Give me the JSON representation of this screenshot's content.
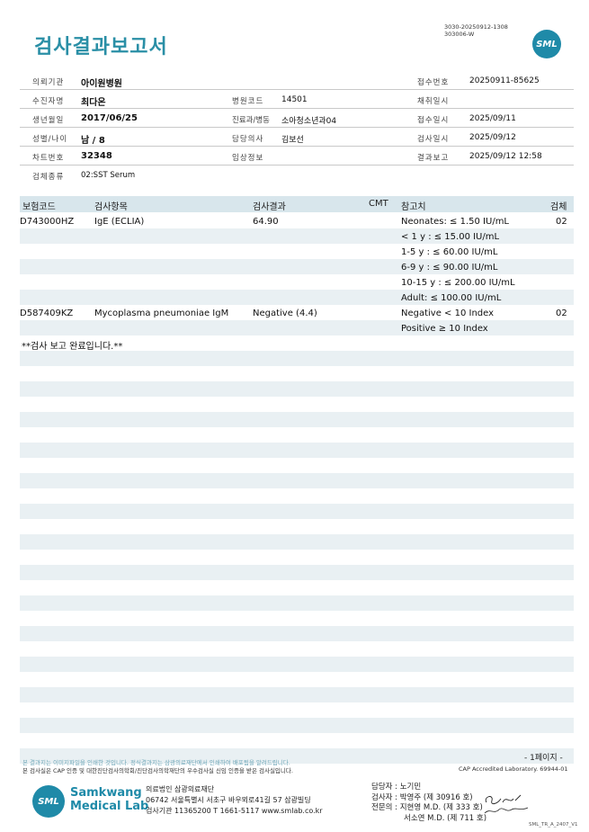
{
  "title": "검사결과보고서",
  "doc_ids": [
    "3030-20250912-1308",
    "303006-W"
  ],
  "logo_text": "SML",
  "header": {
    "client_label": "의뢰기관",
    "client": "아이원병원",
    "receipt_no_label": "접수번호",
    "receipt_no": "20250911-85625",
    "patient_label": "수진자명",
    "patient": "최다온",
    "hospital_code_label": "병원코드",
    "hospital_code": "14501",
    "collect_date_label": "채취일시",
    "collect_date": "",
    "dob_label": "생년월일",
    "dob": "2017/06/25",
    "dept_label": "진료과/병동",
    "dept": "소아청소년과04",
    "receipt_date_label": "접수일시",
    "receipt_date": "2025/09/11",
    "sex_age_label": "성별/나이",
    "sex_age": "남 / 8",
    "doctor_label": "담당의사",
    "doctor": "김보선",
    "test_date_label": "검사일시",
    "test_date": "2025/09/12",
    "chart_no_label": "차트번호",
    "chart_no": "32348",
    "clinical_label": "임상정보",
    "clinical": "",
    "report_label": "결과보고",
    "report_date": "2025/09/12 12:58",
    "specimen_label": "검체종류",
    "specimen": "02:SST Serum"
  },
  "table": {
    "columns": [
      "보험코드",
      "검사항목",
      "검사결과",
      "CMT",
      "참고치",
      "검체"
    ],
    "rows": [
      {
        "code": "D743000HZ",
        "item": "IgE (ECLIA)",
        "result": "64.90",
        "cmt": "",
        "specimen": "02",
        "refs": [
          "Neonates: ≤ 1.50 IU/mL",
          "< 1 y : ≤ 15.00 IU/mL",
          "1-5 y : ≤ 60.00 IU/mL",
          "6-9 y : ≤ 90.00 IU/mL",
          "10-15 y : ≤ 200.00 IU/mL",
          "Adult: ≤ 100.00 IU/mL"
        ]
      },
      {
        "code": "D587409KZ",
        "item": "Mycoplasma pneumoniae IgM",
        "result": "Negative (4.4)",
        "cmt": "",
        "specimen": "02",
        "refs": [
          "Negative < 10 Index",
          "Positive ≥ 10 Index"
        ]
      }
    ],
    "end_note": "**검사 보고 완료입니다.**"
  },
  "footer": {
    "note1": "본 결과지는 이미지파일을 인쇄한 것입니다. 정식결과지는 삼광의료재단에서 인쇄하여 배포됨을 알려드립니다.",
    "note2": "본 검사실은 CAP 인증 및 대한진단검사의학회/진단검사의학재단의 우수검사실 신임 인증을 받은 검사실입니다.",
    "page": "- 1페이지 -",
    "cap": "CAP Accredited Laboratory. 69944-01",
    "brand_line1": "Samkwang",
    "brand_line2": "Medical Lab",
    "org_line1": "의료법인 삼광의료재단",
    "org_line2": "06742 서울특별시 서초구 바우뫼로41길 57 삼광빌딩",
    "org_line3": "검사기관 11365200 T 1661-5117 www.smlab.co.kr",
    "staff_line1": "담당자 :  노기민",
    "staff_line2": "검사자 :  박영주 (제 30916 호)",
    "staff_line3": "전문의 :  지현영 M.D. (제 333 호)",
    "staff_line4": "서소연 M.D. (제 711 호)",
    "form_code": "SML_TR_A_2407_V1"
  }
}
